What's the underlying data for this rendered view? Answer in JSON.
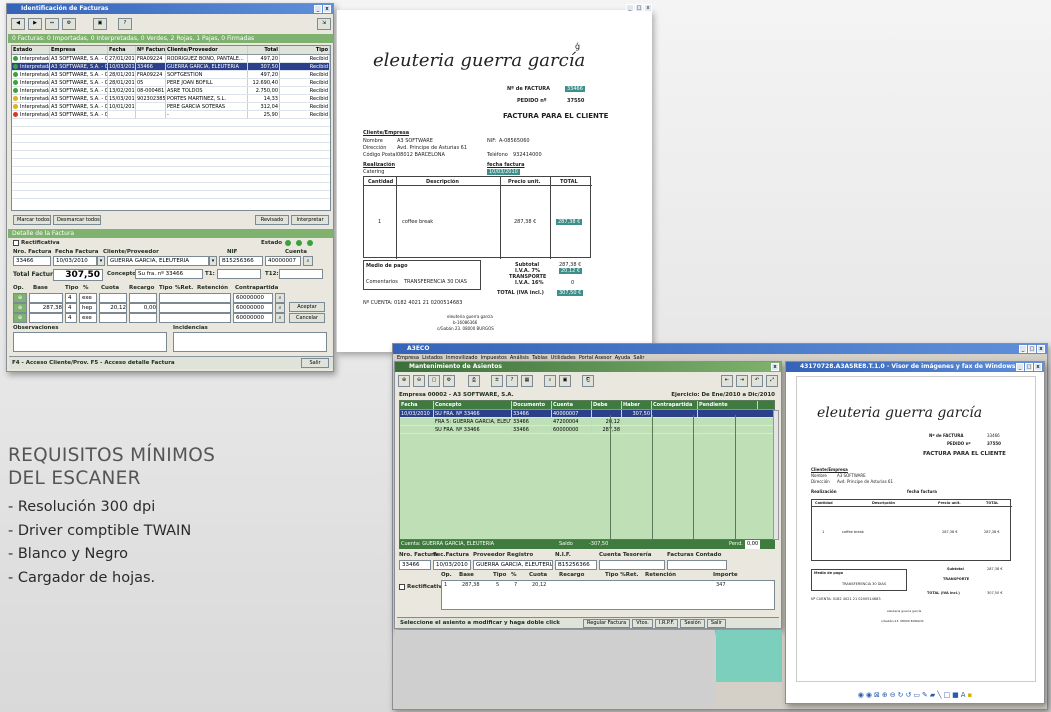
{
  "window1": {
    "title": "Identificación de Facturas",
    "status_band": "0 Facturas: 0 Importadas, 0 Interpretadas, 0 Verdes, 2 Rojas, 1 Pajas, 0 Firmadas",
    "columns": [
      "Estado",
      "Empresa",
      "Fecha",
      "Nº Factura",
      "Cliente/Proveedor",
      "Total",
      "Tipo"
    ],
    "rows": [
      {
        "estado": "Interpretada",
        "empresa": "A3 SOFTWARE, S.A. - 00002",
        "fecha": "27/01/2010",
        "num": "FRA09224",
        "cliente": "RODRIGUEZ BONO, PANTALE...",
        "total": "497,20",
        "tipo": "Recibid",
        "dot": "#3aa23a",
        "sel": false
      },
      {
        "estado": "Interpretada",
        "empresa": "A3 SOFTWARE, S.A. - 00002",
        "fecha": "10/03/2010",
        "num": "33466",
        "cliente": "GUERRA GARCIA, ELEUTERIA",
        "total": "307,50",
        "tipo": "Recibid",
        "dot": "#3aa23a",
        "sel": true
      },
      {
        "estado": "Interpretada",
        "empresa": "A3 SOFTWARE, S.A. - 00002",
        "fecha": "28/01/2010",
        "num": "FRA09224",
        "cliente": "SOFTGESTION",
        "total": "497,20",
        "tipo": "Recibid",
        "dot": "#3aa23a",
        "sel": false
      },
      {
        "estado": "Interpretada",
        "empresa": "A3 SOFTWARE, S.A. - 00002",
        "fecha": "28/01/2010",
        "num": "05",
        "cliente": "PERE JOAN BOFILL",
        "total": "12.690,40",
        "tipo": "Recibid",
        "dot": "#3aa23a",
        "sel": false
      },
      {
        "estado": "Interpretada",
        "empresa": "A3 SOFTWARE, S.A. - 00002",
        "fecha": "13/02/2010",
        "num": "08-000481",
        "cliente": "ASRE TOLDOS",
        "total": "2.750,00",
        "tipo": "Recibid",
        "dot": "#3aa23a",
        "sel": false
      },
      {
        "estado": "Interpretada",
        "empresa": "A3 SOFTWARE, S.A. - 00002",
        "fecha": "15/03/2010",
        "num": "902302385",
        "cliente": "PORTES MARTINEZ, S.L.",
        "total": "14,33",
        "tipo": "Recibid",
        "dot": "#e0b020",
        "sel": false
      },
      {
        "estado": "Interpretada",
        "empresa": "A3 SOFTWARE, S.A. - 00002",
        "fecha": "10/01/2010",
        "num": "",
        "cliente": "PERE GARCIA SOTERAS",
        "total": "312,04",
        "tipo": "Recibid",
        "dot": "#e0b020",
        "sel": false
      },
      {
        "estado": "Interpretada",
        "empresa": "A3 SOFTWARE, S.A. - 00002",
        "fecha": "",
        "num": "",
        "cliente": "-",
        "total": "25,90",
        "tipo": "Recibid",
        "dot": "#d23a2a",
        "sel": false
      }
    ],
    "btn_marcar": "Marcar todos",
    "btn_desmarcar": "Desmarcar todos",
    "btn_revisado": "Revisado",
    "btn_interpretar": "Interpretar",
    "detail_band": "Detalle de la Factura",
    "rectificativa": "Rectificativa",
    "estado_label": "Estado",
    "h_nro": "Nro. Factura",
    "h_fecha": "Fecha Factura",
    "h_cliente": "Cliente/Proveedor",
    "h_nif": "NIF",
    "h_cuenta": "Cuenta",
    "v_nro": "33466",
    "v_fecha": "10/03/2010",
    "v_cliente": "GUERRA GARCIA, ELEUTERIA",
    "v_nif": "B15256366",
    "v_cuenta": "40000007",
    "total_label": "Total Factura",
    "total_value": "307,50",
    "concepto_label": "Concepto",
    "concepto_value": "Su fra. nº 33466",
    "t1": "T1:",
    "t2": "T12:",
    "op_headers": [
      "Op.",
      "Base",
      "Tipo",
      "%",
      "Cuota",
      "Recargo",
      "Tipo",
      "%Ret.",
      "Retención",
      "Contrapartida"
    ],
    "op_rows": [
      {
        "base": "",
        "tipo": "4",
        "pct": "exe",
        "cuota": "",
        "rec": "",
        "contra": "60000000"
      },
      {
        "base": "287,38",
        "tipo": "4",
        "pct": "hep",
        "cuota": "20,12",
        "rec": "0,00",
        "contra": "60000000"
      },
      {
        "base": "",
        "tipo": "4",
        "pct": "exe",
        "cuota": "",
        "rec": "",
        "contra": "60000000"
      }
    ],
    "btn_aceptar": "Aceptar",
    "btn_cancelar": "Cancelar",
    "obs_label": "Observaciones",
    "inc_label": "Incidencias",
    "footer": "F4 - Acceso Cliente/Prov. F5 - Acceso detalle Factura",
    "btn_salir": "Salir"
  },
  "invoice": {
    "brand": "eleuteria guerra garcía",
    "num_label": "Nº de FACTURA",
    "num_value": "33466",
    "pedido_label": "PEDIDO nº",
    "pedido_value": "37550",
    "heading": "FACTURA PARA EL CLIENTE",
    "cliente_heading": "Cliente/Empresa",
    "nombre_label": "Nombre",
    "nombre_value": "A3 SOFTWARE",
    "nif_label": "NIF:",
    "nif_value": "A-08565060",
    "direccion_label": "Dirección",
    "direccion_value": "Avd. Principe de Asturias 61",
    "cp_label": "Código Postal",
    "cp_value": "08012 BARCELONA",
    "telefono_label": "Teléfono",
    "telefono_value": "932414000",
    "realizacion_label": "Realización",
    "realizacion_value": "Catering",
    "fecha_label": "fecha factura",
    "fecha_value": "10/03/2010",
    "col_cantidad": "Cantidad",
    "col_descripcion": "Descripción",
    "col_precio": "Precio unit.",
    "col_total": "TOTAL",
    "line_qty": "1",
    "line_desc": "coffee break",
    "line_price": "287,38 €",
    "line_total": "287,38 €",
    "subtotal_label": "Subtotal",
    "subtotal_value": "287,38 €",
    "iva7_label": "I.V.A. 7%",
    "iva7_value": "20,12 €",
    "transporte_label": "TRANSPORTE",
    "iva16_label": "I.V.A. 16%",
    "iva16_value": "0",
    "total_label": "TOTAL (IVA incl.)",
    "total_value": "307,50 €",
    "medio_label": "Medio de pago",
    "comentarios_label": "Comentarios",
    "comentarios_value": "TRANSFERENCIA 30 DIAS",
    "cuenta_line": "Nº CUENTA: 0182 4021 21 0200514683",
    "footer1": "eleuteria guerra garcía",
    "footer2": "b-16086366",
    "footer3": "c/Gabán 23. 08000 BURGOS"
  },
  "window2": {
    "title": "A3ECO",
    "menu": "Empresa  Listados  Inmovilizado  Impuestos  Análisis  Tablas  Utilidades  Portal Asesor  Ayuda  Salir",
    "sub_title": "Mantenimiento de Asientos",
    "empresa": "Empresa 00002 - A3 SOFTWARE, S.A.",
    "ejercicio": "Ejercicio: De Ene/2010 a Dic/2010",
    "columns": [
      "Fecha",
      "Concepto",
      "Documento",
      "Cuenta",
      "Debe",
      "Haber",
      "Contrapartida"
    ],
    "entries": [
      {
        "fecha": "10/03/2010",
        "concepto": "SU FRA. Nº 33466",
        "doc": "33466",
        "cuenta": "40000007",
        "debe": "",
        "haber": "307,50"
      },
      {
        "fecha": "",
        "concepto": "FRA 5: GUERRA GARCIA, ELEUTER",
        "doc": "33466",
        "cuenta": "47200004",
        "debe": "20,12",
        "haber": ""
      },
      {
        "fecha": "",
        "concepto": "SU FRA. Nº 33466",
        "doc": "33466",
        "cuenta": "60000000",
        "debe": "287,38",
        "haber": ""
      }
    ],
    "pendiente": "Pendiente",
    "cuenta_bar": "Cuenta: GUERRA GARCIA, ELEUTERIA",
    "saldo_label": "Saldo",
    "saldo_value": "-307,50",
    "pend_label": "Pend.",
    "pend_value": "0,00",
    "h2": [
      "Nro. Factura",
      "Fec.Factura",
      "Proveedor Registro",
      "N.I.F.",
      "Cuenta Tesorería",
      "Facturas Contado"
    ],
    "r2": [
      "33466",
      "10/03/2010",
      "GUERRA GARCIA, ELEUTERIA",
      "B15256366"
    ],
    "rect": "Rectificativa",
    "h3": [
      "Op.",
      "Base",
      "Tipo",
      "%",
      "Cuota",
      "Recargo",
      "Tipo %Ret.",
      "Retención",
      "Importe"
    ],
    "r3": [
      "1",
      "287,38",
      "5",
      "7",
      "20,12",
      "",
      "",
      "",
      "347"
    ],
    "status": "Seleccione el asiento a modificar y haga doble click",
    "btns": [
      "Regular Factura",
      "Vtos.",
      "I.R.P.F.",
      "Sesión",
      "Salir"
    ]
  },
  "window3": {
    "title": "43170728.A3ASRE8.T.1.0 - Visor de imágenes y fax de Windows"
  },
  "requirements": {
    "title_line1": "REQUISITOS MÍNIMOS",
    "title_line2": "DEL ESCANER",
    "items": [
      "- Resolución 300 dpi",
      "- Driver comptible TWAIN",
      "- Blanco y Negro",
      "- Cargador de hojas."
    ]
  }
}
